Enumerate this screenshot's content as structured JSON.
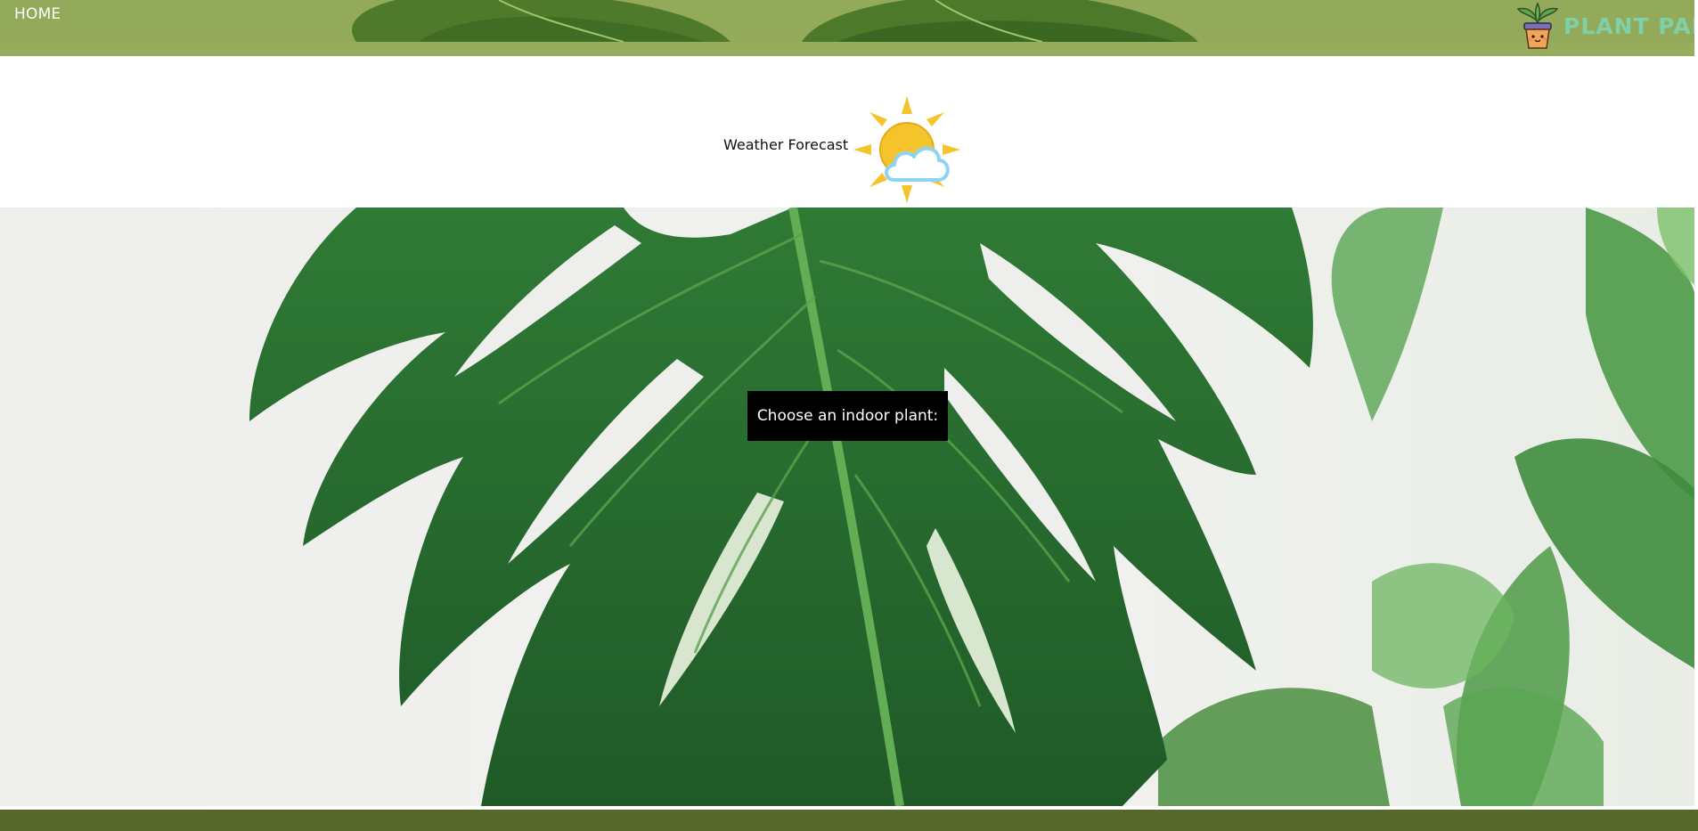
{
  "nav": {
    "home_label": "HOME"
  },
  "brand": {
    "name": "PLANT PAL",
    "text_color": "#7fd0a6",
    "icon": "potted-plant-mascot-icon"
  },
  "weather": {
    "label": "Weather Forecast",
    "icon": "partly-sunny-icon"
  },
  "hero": {
    "button_label": "Choose an indoor plant:",
    "background": "monstera-leaf-photo"
  },
  "colors": {
    "header": "#97ad5c",
    "footer": "#56692b",
    "button_bg": "#000000",
    "button_text": "#ffffff",
    "sun": "#f5c32c",
    "cloud_outline": "#8fd3f4"
  }
}
